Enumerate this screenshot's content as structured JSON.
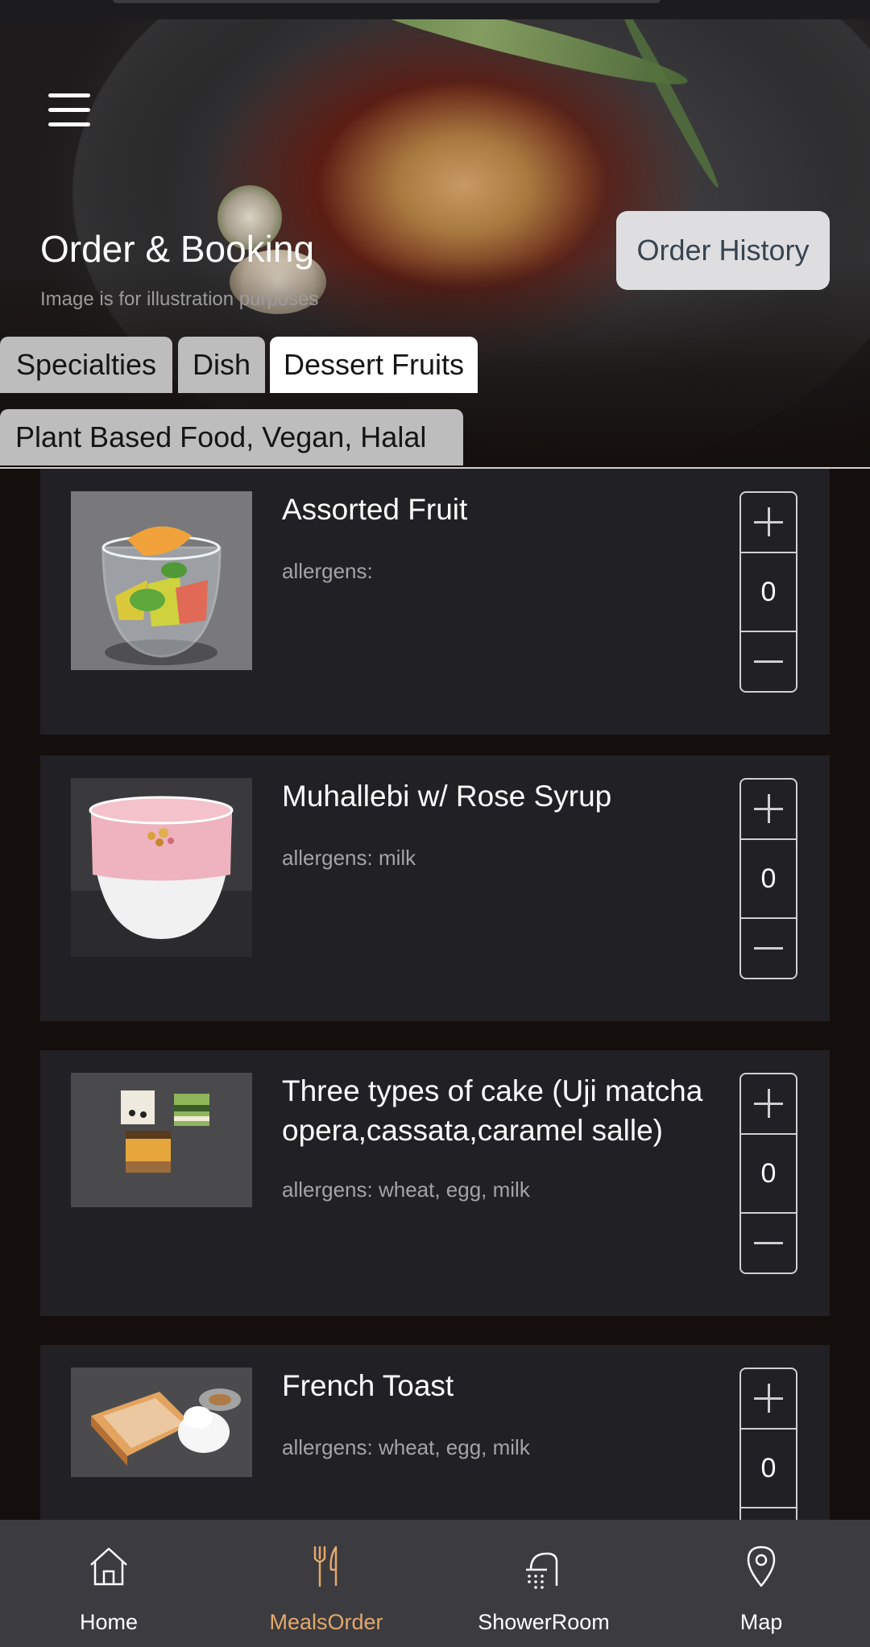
{
  "header": {
    "title": "Order & Booking",
    "subtitle": "Image is for illustration purposes",
    "order_history_label": "Order History",
    "menu_icon": "hamburger-menu-icon"
  },
  "tabs": [
    {
      "label": "Specialties",
      "active": false
    },
    {
      "label": "Dish",
      "active": false
    },
    {
      "label": "Dessert Fruits",
      "active": true
    },
    {
      "label": "Plant Based Food, Vegan, Halal",
      "active": false
    }
  ],
  "items": [
    {
      "name": "Assorted Fruit",
      "allergens": "allergens:",
      "qty": "0"
    },
    {
      "name": "Muhallebi w/ Rose Syrup",
      "allergens": "allergens: milk",
      "qty": "0"
    },
    {
      "name": "Three types of cake (Uji matcha opera,cassata,caramel salle)",
      "allergens": "allergens: wheat, egg, milk",
      "qty": "0"
    },
    {
      "name": "French Toast",
      "allergens": "allergens: wheat, egg, milk",
      "qty": "0"
    }
  ],
  "bottom_nav": [
    {
      "label": "Home",
      "icon": "home-icon",
      "active": false
    },
    {
      "label": "MealsOrder",
      "icon": "fork-knife-icon",
      "active": true
    },
    {
      "label": "ShowerRoom",
      "icon": "shower-icon",
      "active": false
    },
    {
      "label": "Map",
      "icon": "map-pin-icon",
      "active": false
    }
  ],
  "colors": {
    "background": "#140f0d",
    "card": "#212024",
    "active_nav": "#e4a86b",
    "nav_bar": "#3c3b40",
    "tab_inactive": "#bdbdbd",
    "tab_active": "#ffffff"
  }
}
